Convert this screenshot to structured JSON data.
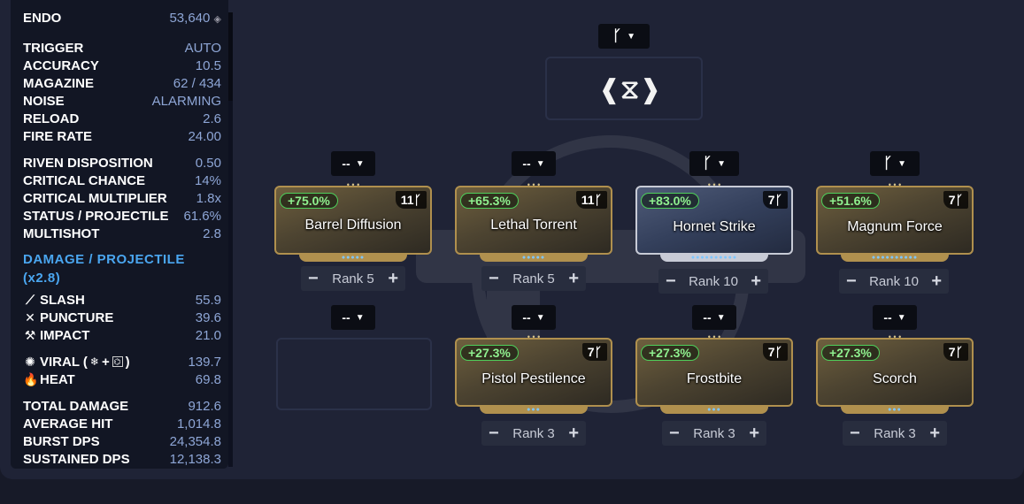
{
  "stats": {
    "endo": {
      "label": "ENDO",
      "value": "53,640"
    },
    "group1": [
      {
        "label": "TRIGGER",
        "value": "AUTO"
      },
      {
        "label": "ACCURACY",
        "value": "10.5"
      },
      {
        "label": "MAGAZINE",
        "value": "62 / 434"
      },
      {
        "label": "NOISE",
        "value": "ALARMING"
      },
      {
        "label": "RELOAD",
        "value": "2.6"
      },
      {
        "label": "FIRE RATE",
        "value": "24.00"
      }
    ],
    "group2": [
      {
        "label": "RIVEN DISPOSITION",
        "value": "0.50"
      },
      {
        "label": "CRITICAL CHANCE",
        "value": "14%"
      },
      {
        "label": "CRITICAL MULTIPLIER",
        "value": "1.8x"
      },
      {
        "label": "STATUS / PROJECTILE",
        "value": "61.6%"
      },
      {
        "label": "MULTISHOT",
        "value": "2.8"
      }
    ],
    "damage_title": "DAMAGE / PROJECTILE",
    "damage_multiplier": "(x2.8)",
    "physical": [
      {
        "icon": "slash-icon",
        "label": "SLASH",
        "value": "55.9"
      },
      {
        "icon": "puncture-icon",
        "label": "PUNCTURE",
        "value": "39.6"
      },
      {
        "icon": "impact-icon",
        "label": "IMPACT",
        "value": "21.0"
      }
    ],
    "elemental": [
      {
        "icon": "viral-icon",
        "label": "VIRAL (",
        "suffix": ")",
        "value": "139.7"
      },
      {
        "icon": "heat-icon",
        "label": "HEAT",
        "value": "69.8"
      }
    ],
    "group3": [
      {
        "label": "TOTAL DAMAGE",
        "value": "912.6"
      },
      {
        "label": "AVERAGE HIT",
        "value": "1,014.8"
      },
      {
        "label": "BURST DPS",
        "value": "24,354.8"
      },
      {
        "label": "SUSTAINED DPS",
        "value": "12,138.3"
      }
    ]
  },
  "exilus": {
    "polarity": "ᚴ",
    "icon": "exilus-icon"
  },
  "mods": [
    {
      "polarity": "--",
      "name": "Barrel Diffusion",
      "bonus": "+75.0%",
      "drain": "11",
      "rank": "Rank 5",
      "tier": "gold"
    },
    {
      "polarity": "--",
      "name": "Lethal Torrent",
      "bonus": "+65.3%",
      "drain": "11",
      "rank": "Rank 5",
      "tier": "gold"
    },
    {
      "polarity": "ᚴ",
      "name": "Hornet Strike",
      "bonus": "+83.0%",
      "drain": "7",
      "rank": "Rank 10",
      "tier": "silver"
    },
    {
      "polarity": "ᚴ",
      "name": "Magnum Force",
      "bonus": "+51.6%",
      "drain": "7",
      "rank": "Rank 10",
      "tier": "gold"
    },
    {
      "polarity": "--",
      "name": "",
      "bonus": "",
      "drain": "",
      "rank": "",
      "tier": "empty"
    },
    {
      "polarity": "--",
      "name": "Pistol Pestilence",
      "bonus": "+27.3%",
      "drain": "7",
      "rank": "Rank 3",
      "tier": "gold"
    },
    {
      "polarity": "--",
      "name": "Frostbite",
      "bonus": "+27.3%",
      "drain": "7",
      "rank": "Rank 3",
      "tier": "gold"
    },
    {
      "polarity": "--",
      "name": "Scorch",
      "bonus": "+27.3%",
      "drain": "7",
      "rank": "Rank 3",
      "tier": "gold"
    }
  ],
  "symbols": {
    "polarity_glyph": "ᚴ",
    "caret": "▼",
    "minus": "−",
    "plus": "+"
  }
}
